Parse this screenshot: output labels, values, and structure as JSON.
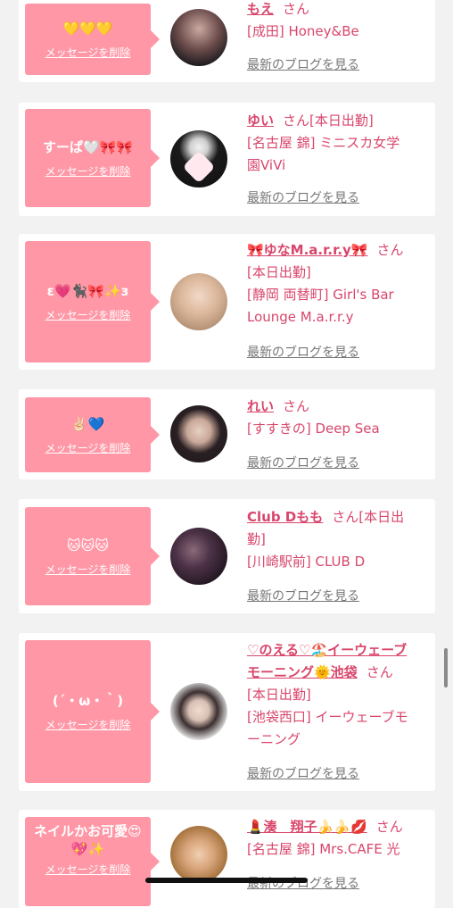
{
  "delete_label": "メッセージを削除",
  "blog_label": "最新のブログを見る",
  "san": "さん",
  "cards": [
    {
      "msg": "💛💛💛",
      "name": "もえ",
      "lines": [
        "[成田] Honey&Be"
      ]
    },
    {
      "msg": "すーぱ🤍🎀🎀",
      "name": "ゆい",
      "suffix": "[本日出勤]",
      "lines": [
        "[名古屋 錦] ミニスカ女学",
        "園ViVi"
      ]
    },
    {
      "msg": "ε💗🐈‍⬛🎀✨з",
      "name": "🎀ゆなM.a.r.r.y🎀",
      "lines": [
        "[本日出勤]",
        "[静岡 両替町] Girl's Bar",
        "Lounge M.a.r.r.y"
      ]
    },
    {
      "msg": "✌🏻💙",
      "name": "れい",
      "lines": [
        "[すすきの] Deep Sea"
      ]
    },
    {
      "msg": "🐱🐱🐱",
      "name": "Club Dもも",
      "suffix": "[本日出",
      "lines": [
        "勤]",
        "[川崎駅前] CLUB D"
      ]
    },
    {
      "msg": "(´・ω・｀)",
      "name_lines": [
        "♡のえる♡🏖️イーウェーブ",
        "モーニング🌞池袋"
      ],
      "lines": [
        "[本日出勤]",
        "[池袋西口] イーウェーブモ",
        "ーニング"
      ]
    },
    {
      "msg_lines": [
        "ネイルかお可愛😍",
        "💖✨"
      ],
      "name": "💄湊　翔子🍌🍌💋",
      "lines": [
        "[名古屋 錦] Mrs.CAFE 光"
      ]
    }
  ],
  "colors": {
    "accent": "#d9466b",
    "bubble": "#ff97a6",
    "background": "#f2f2f2"
  }
}
